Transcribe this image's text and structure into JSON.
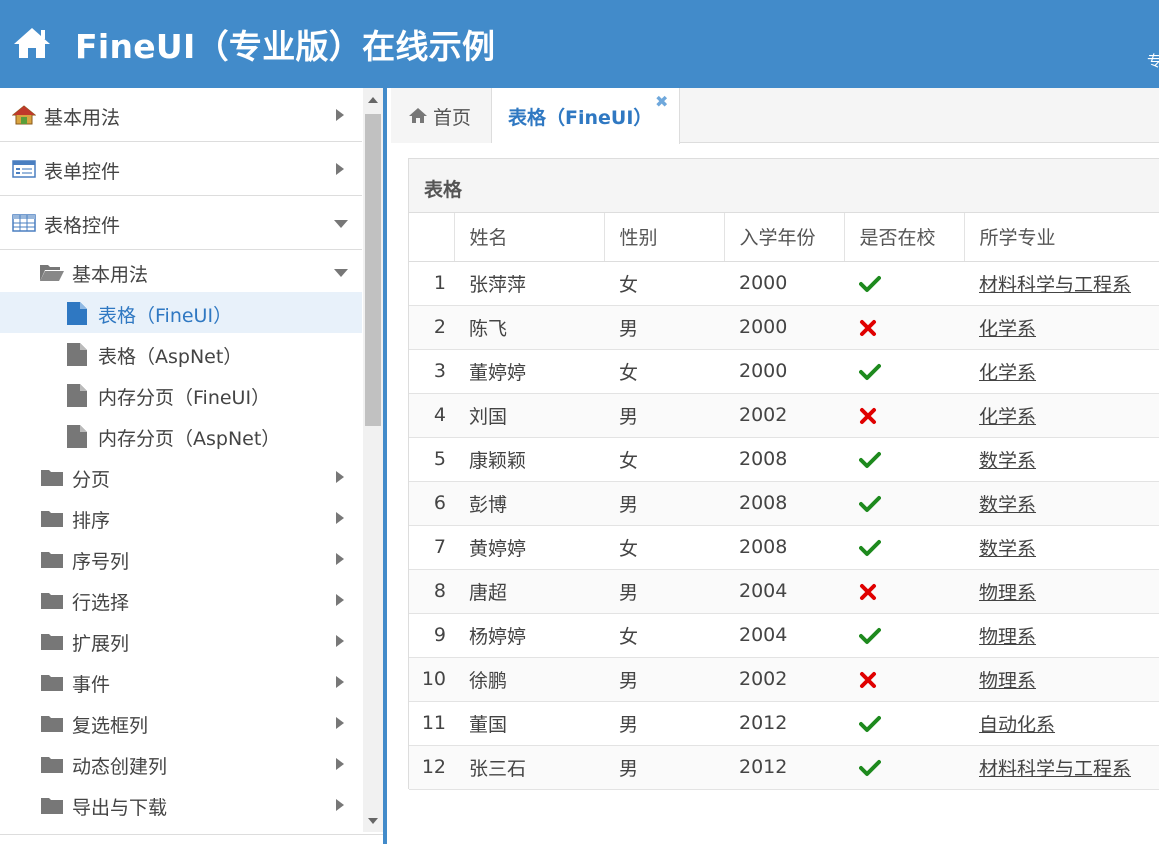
{
  "header": {
    "title": "FineUI（专业版）在线示例",
    "right_text": "专"
  },
  "sidebar": {
    "groups": [
      {
        "label": "基本用法",
        "icon": "house-icon",
        "expanded": false
      },
      {
        "label": "表单控件",
        "icon": "form-icon",
        "expanded": false
      },
      {
        "label": "表格控件",
        "icon": "table-icon",
        "expanded": true
      }
    ],
    "items": [
      {
        "label": "基本用法",
        "icon": "folder-open-icon",
        "expanded": true
      },
      {
        "label": "表格（FineUI）",
        "icon": "file-icon",
        "active": true
      },
      {
        "label": "表格（AspNet）",
        "icon": "file-icon"
      },
      {
        "label": "内存分页（FineUI）",
        "icon": "file-icon"
      },
      {
        "label": "内存分页（AspNet）",
        "icon": "file-icon"
      },
      {
        "label": "分页",
        "icon": "folder-icon"
      },
      {
        "label": "排序",
        "icon": "folder-icon"
      },
      {
        "label": "序号列",
        "icon": "folder-icon"
      },
      {
        "label": "行选择",
        "icon": "folder-icon"
      },
      {
        "label": "扩展列",
        "icon": "folder-icon"
      },
      {
        "label": "事件",
        "icon": "folder-icon"
      },
      {
        "label": "复选框列",
        "icon": "folder-icon"
      },
      {
        "label": "动态创建列",
        "icon": "folder-icon"
      },
      {
        "label": "导出与下载",
        "icon": "folder-icon"
      }
    ]
  },
  "tabs": [
    {
      "label": "首页",
      "icon": "home-icon"
    },
    {
      "label": "表格（FineUI）",
      "active": true,
      "close_icon": "close-icon"
    }
  ],
  "panel": {
    "title": "表格"
  },
  "grid": {
    "columns": [
      "",
      "姓名",
      "性别",
      "入学年份",
      "是否在校",
      "所学专业"
    ],
    "rows": [
      {
        "num": "1",
        "name": "张萍萍",
        "gender": "女",
        "year": "2000",
        "in_school": true,
        "major": "材料科学与工程系"
      },
      {
        "num": "2",
        "name": "陈飞",
        "gender": "男",
        "year": "2000",
        "in_school": false,
        "major": "化学系"
      },
      {
        "num": "3",
        "name": "董婷婷",
        "gender": "女",
        "year": "2000",
        "in_school": true,
        "major": "化学系"
      },
      {
        "num": "4",
        "name": "刘国",
        "gender": "男",
        "year": "2002",
        "in_school": false,
        "major": "化学系"
      },
      {
        "num": "5",
        "name": "康颖颖",
        "gender": "女",
        "year": "2008",
        "in_school": true,
        "major": "数学系"
      },
      {
        "num": "6",
        "name": "彭博",
        "gender": "男",
        "year": "2008",
        "in_school": true,
        "major": "数学系"
      },
      {
        "num": "7",
        "name": "黄婷婷",
        "gender": "女",
        "year": "2008",
        "in_school": true,
        "major": "数学系"
      },
      {
        "num": "8",
        "name": "唐超",
        "gender": "男",
        "year": "2004",
        "in_school": false,
        "major": "物理系"
      },
      {
        "num": "9",
        "name": "杨婷婷",
        "gender": "女",
        "year": "2004",
        "in_school": true,
        "major": "物理系"
      },
      {
        "num": "10",
        "name": "徐鹏",
        "gender": "男",
        "year": "2002",
        "in_school": false,
        "major": "物理系"
      },
      {
        "num": "11",
        "name": "董国",
        "gender": "男",
        "year": "2012",
        "in_school": true,
        "major": "自动化系"
      },
      {
        "num": "12",
        "name": "张三石",
        "gender": "男",
        "year": "2012",
        "in_school": true,
        "major": "材料科学与工程系"
      }
    ]
  },
  "colors": {
    "header_bg": "#428bca",
    "accent": "#2f78c2",
    "check": "#1e8a1e",
    "cross": "#e00000"
  }
}
